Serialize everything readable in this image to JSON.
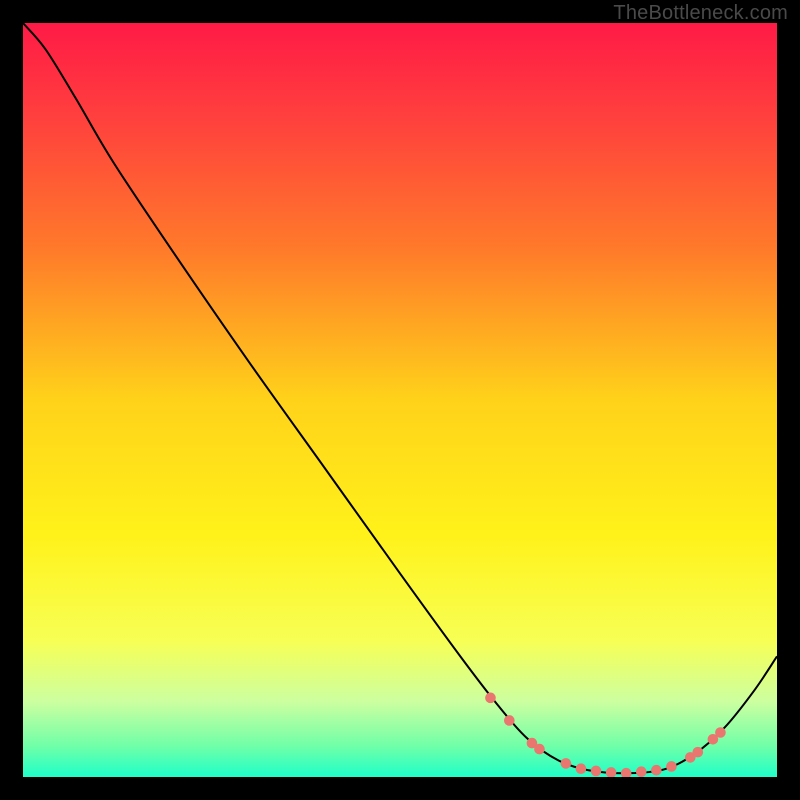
{
  "watermark": "TheBottleneck.com",
  "chart_data": {
    "type": "line",
    "title": "",
    "xlabel": "",
    "ylabel": "",
    "xlim": [
      0,
      100
    ],
    "ylim": [
      0,
      100
    ],
    "background_gradient": {
      "stops": [
        {
          "offset": 0.0,
          "color": "#ff1a46"
        },
        {
          "offset": 0.12,
          "color": "#ff3e3e"
        },
        {
          "offset": 0.3,
          "color": "#ff7a2a"
        },
        {
          "offset": 0.5,
          "color": "#ffd21a"
        },
        {
          "offset": 0.68,
          "color": "#fff21a"
        },
        {
          "offset": 0.82,
          "color": "#f7ff55"
        },
        {
          "offset": 0.9,
          "color": "#ccffa0"
        },
        {
          "offset": 0.96,
          "color": "#6effa8"
        },
        {
          "offset": 1.0,
          "color": "#1effc8"
        }
      ]
    },
    "series": [
      {
        "name": "bottleneck-curve",
        "color": "#000000",
        "points": [
          {
            "x": 0.0,
            "y": 100.0
          },
          {
            "x": 3.0,
            "y": 96.5
          },
          {
            "x": 7.0,
            "y": 90.0
          },
          {
            "x": 12.0,
            "y": 81.5
          },
          {
            "x": 20.0,
            "y": 69.5
          },
          {
            "x": 30.0,
            "y": 55.0
          },
          {
            "x": 40.0,
            "y": 41.0
          },
          {
            "x": 50.0,
            "y": 27.0
          },
          {
            "x": 58.0,
            "y": 16.0
          },
          {
            "x": 63.0,
            "y": 9.5
          },
          {
            "x": 67.0,
            "y": 5.0
          },
          {
            "x": 71.0,
            "y": 2.2
          },
          {
            "x": 75.0,
            "y": 0.9
          },
          {
            "x": 80.0,
            "y": 0.5
          },
          {
            "x": 85.0,
            "y": 1.0
          },
          {
            "x": 89.0,
            "y": 3.0
          },
          {
            "x": 93.0,
            "y": 6.5
          },
          {
            "x": 97.0,
            "y": 11.5
          },
          {
            "x": 100.0,
            "y": 16.0
          }
        ]
      }
    ],
    "markers": {
      "name": "sample-dots",
      "color": "#e9766f",
      "radius": 5.3,
      "points": [
        {
          "x": 62.0,
          "y": 10.5
        },
        {
          "x": 64.5,
          "y": 7.5
        },
        {
          "x": 67.5,
          "y": 4.5
        },
        {
          "x": 68.5,
          "y": 3.7
        },
        {
          "x": 72.0,
          "y": 1.8
        },
        {
          "x": 74.0,
          "y": 1.1
        },
        {
          "x": 76.0,
          "y": 0.8
        },
        {
          "x": 78.0,
          "y": 0.6
        },
        {
          "x": 80.0,
          "y": 0.5
        },
        {
          "x": 82.0,
          "y": 0.7
        },
        {
          "x": 84.0,
          "y": 0.9
        },
        {
          "x": 86.0,
          "y": 1.4
        },
        {
          "x": 88.5,
          "y": 2.6
        },
        {
          "x": 89.5,
          "y": 3.3
        },
        {
          "x": 91.5,
          "y": 5.0
        },
        {
          "x": 92.5,
          "y": 5.9
        }
      ]
    }
  }
}
